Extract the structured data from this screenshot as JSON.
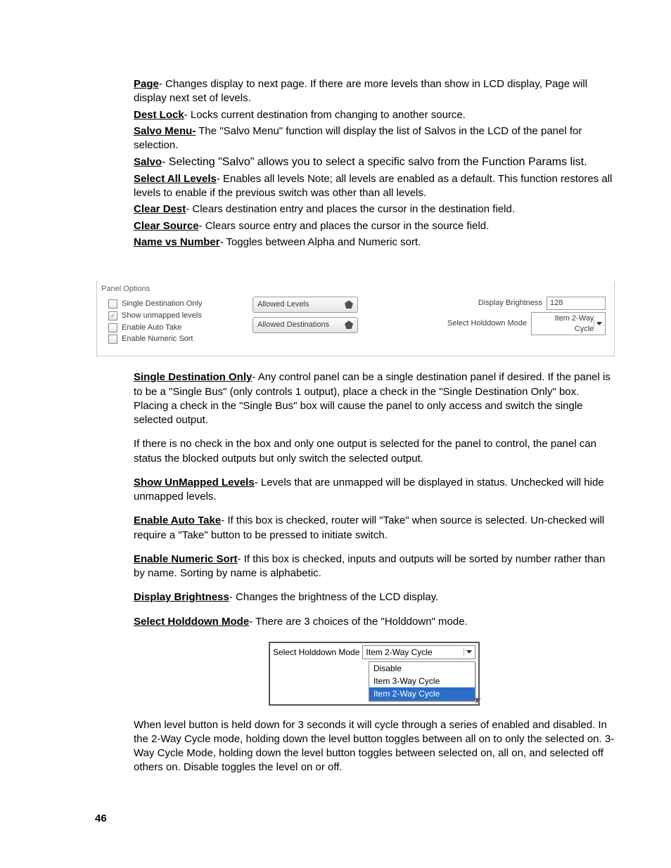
{
  "defs": [
    {
      "term": "Page",
      "text": "- Changes display to next page. If there are more levels than show in LCD display, Page will display next set of levels."
    },
    {
      "term": "Dest Lock",
      "text": "- Locks current destination from changing to another source."
    },
    {
      "term": "Salvo Menu-",
      "text": " The \"Salvo Menu\" function will display the list of Salvos in the LCD of the panel for selection."
    },
    {
      "term": "Salvo",
      "text": "- Selecting \"Salvo\" allows you to select a specific salvo from the Function Params list."
    },
    {
      "term": "Select All Levels",
      "text": "- Enables all levels Note; all levels are enabled as a default. This function restores all levels to enable if the previous switch was other than all levels."
    },
    {
      "term": "Clear Dest",
      "text": "- Clears destination entry and places the cursor in the destination field."
    },
    {
      "term": "Clear Source",
      "text": "- Clears source entry and places the cursor in the source field."
    },
    {
      "term": "Name vs Number",
      "text": "- Toggles between Alpha and Numeric sort."
    }
  ],
  "panel": {
    "title": "Panel Options",
    "checks": [
      {
        "label": "Single Destination Only",
        "checked": false
      },
      {
        "label": "Show unmapped levels",
        "checked": true
      },
      {
        "label": "Enable Auto Take",
        "checked": false
      },
      {
        "label": "Enable Numeric Sort",
        "checked": false
      }
    ],
    "buttons": [
      "Allowed Levels",
      "Allowed Destinations"
    ],
    "brightness_label": "Display Brightness",
    "brightness_value": "128",
    "holddown_label": "Select Holddown Mode",
    "holddown_value": "Item 2-Way Cycle"
  },
  "body2": {
    "sdo_term": "Single Destination Only",
    "sdo_text": "- Any control panel can be a single destination panel if desired. If the panel is to be a \"Single Bus\" (only controls 1 output), place a check in the \"Single Destination Only\" box. Placing a check in the \"Single Bus\" box will cause the panel to only access and switch the single selected output.",
    "sdo_extra": "If there is no check in the box and only one output is selected for the panel to control, the panel can status the blocked outputs but only switch the selected output.",
    "sul_term": "Show UnMapped Levels",
    "sul_text": "- Levels that are unmapped will be displayed in status. Unchecked will hide unmapped levels.",
    "eat_term": "Enable Auto Take",
    "eat_text": "- If this box is checked, router will \"Take\" when source is selected. Un-checked will require a \"Take\" button to be pressed to initiate switch.",
    "ens_term": "Enable Numeric Sort",
    "ens_text": "- If this box is checked, inputs and outputs will be sorted by number rather than by name. Sorting by name is alphabetic.",
    "db_term": "Display Brightness",
    "db_text": "- Changes the brightness of the LCD display.",
    "shm_term": "Select Holddown Mode",
    "shm_text": "- There are 3 choices of the \"Holddown\" mode."
  },
  "holddown_fig": {
    "label": "Select Holddown Mode",
    "current": "Item 2-Way Cycle",
    "options": [
      "Disable",
      "Item 3-Way Cycle",
      "Item 2-Way Cycle"
    ]
  },
  "final": "When level button is held down for 3 seconds it will cycle through a series of enabled and disabled. In the 2-Way Cycle mode, holding down the level button toggles between all on to only the selected on. 3-Way Cycle Mode, holding down the level button toggles between selected on, all on, and selected off others on. Disable toggles the level on or off.",
  "page_number": "46"
}
